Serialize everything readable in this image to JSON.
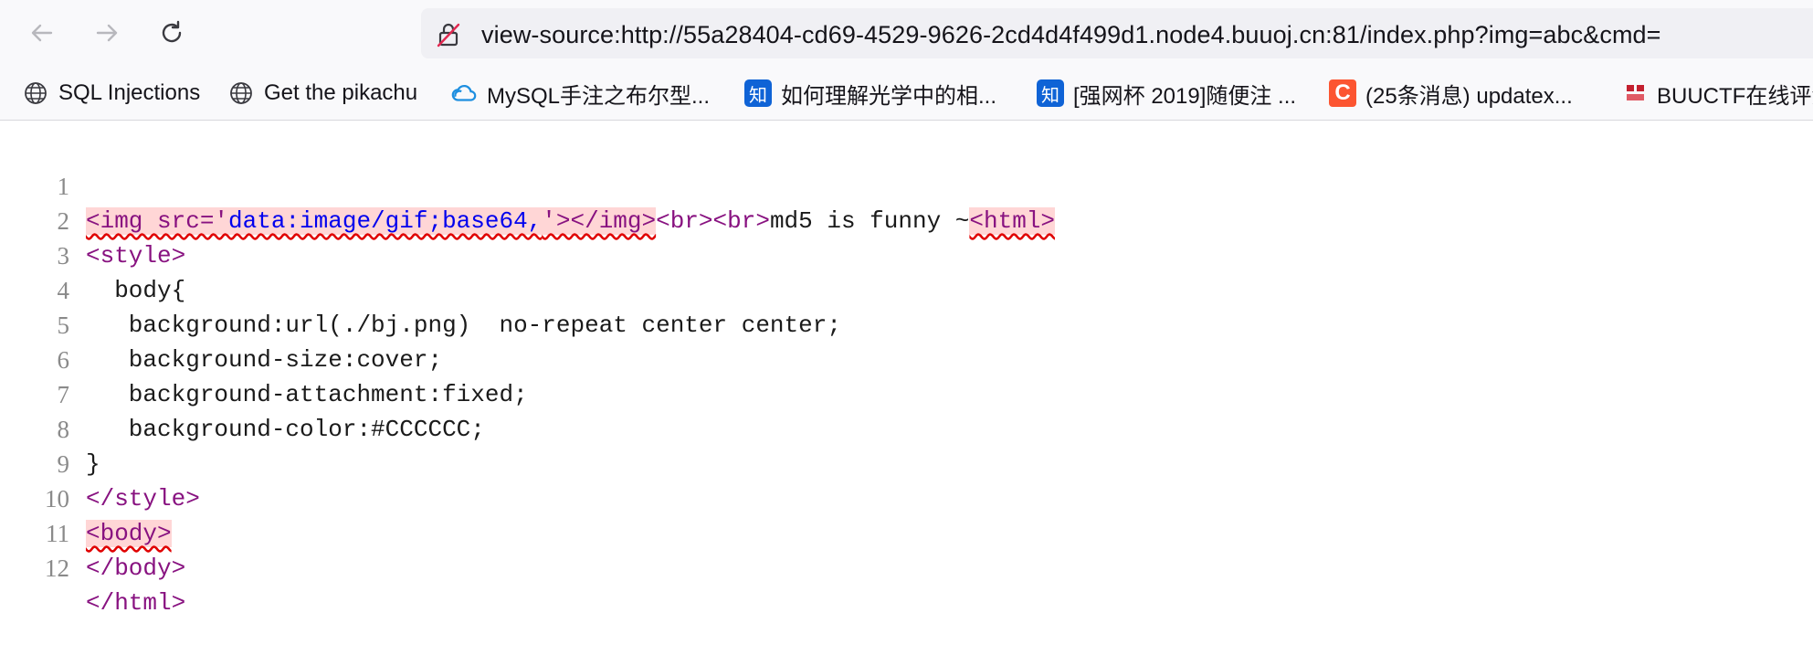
{
  "toolbar": {
    "back_icon": "arrow-left-icon",
    "forward_icon": "arrow-right-icon",
    "reload_icon": "reload-icon",
    "lock_icon": "not-secure-lock-icon",
    "url": "view-source:http://55a28404-cd69-4529-9626-2cd4d4f499d1.node4.buuoj.cn:81/index.php?img=abc&cmd="
  },
  "bookmarks": [
    {
      "label": "SQL Injections",
      "icon": "globe-icon"
    },
    {
      "label": "Get the pikachu",
      "icon": "globe-icon"
    },
    {
      "label": "MySQL手注之布尔型...",
      "icon": "cloud-icon"
    },
    {
      "label": "如何理解光学中的相...",
      "icon": "zhihu-icon",
      "glyph": "知"
    },
    {
      "label": "[强网杯 2019]随便注 ...",
      "icon": "zhihu-icon",
      "glyph": "知"
    },
    {
      "label": "(25条消息) updatex...",
      "icon": "csdn-icon",
      "glyph": "C"
    },
    {
      "label": "BUUCTF在线评测",
      "icon": "buuctf-icon"
    }
  ],
  "source": {
    "line_numbers": [
      "1",
      "2",
      "3",
      "4",
      "5",
      "6",
      "7",
      "8",
      "9",
      "10",
      "11",
      "12"
    ],
    "l1": {
      "img_open": "<img src='",
      "img_src": "data:image/gif;base64,",
      "img_close": "'></img>",
      "br": "<br><br>",
      "text": "md5 is funny ~",
      "html_open": "<html>"
    },
    "l2": "<style>",
    "l3": "  body{",
    "l4": "   background:url(./bj.png)  no-repeat center center;",
    "l5": "   background-size:cover;",
    "l6": "   background-attachment:fixed;",
    "l7": "   background-color:#CCCCCC;",
    "l8": "}",
    "l9": "</style>",
    "l10": "<body>",
    "l11": "</body>",
    "l12": "</html>"
  }
}
